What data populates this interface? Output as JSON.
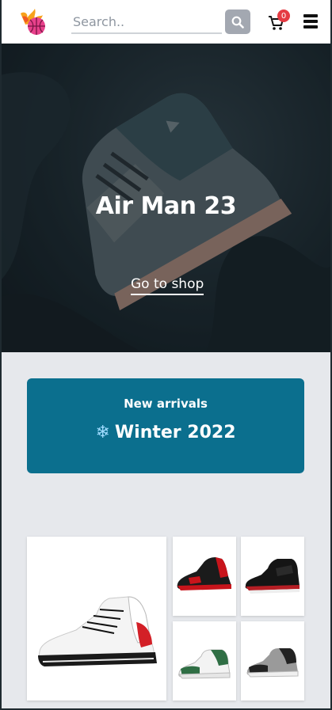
{
  "header": {
    "logo": "basketball-flame-logo",
    "search_placeholder": "Search..",
    "search_icon": "search-icon",
    "cart_icon": "cart-icon",
    "cart_count": "0",
    "menu_icon": "hamburger-menu-icon"
  },
  "hero": {
    "title": "Air Man 23",
    "cta_label": "Go to shop"
  },
  "banner": {
    "subtitle": "New arrivals",
    "icon": "❄",
    "title": "Winter 2022"
  },
  "products": [
    {
      "name": "white-red-high-top-sneaker"
    },
    {
      "name": "black-red-sneaker"
    },
    {
      "name": "black-red-high-top-sneaker"
    },
    {
      "name": "green-white-high-top-sneaker"
    },
    {
      "name": "grey-black-high-top-sneaker"
    }
  ],
  "colors": {
    "banner": "#0b6f8e",
    "badge": "#e53b43",
    "page_bg": "#e6e8ec"
  }
}
